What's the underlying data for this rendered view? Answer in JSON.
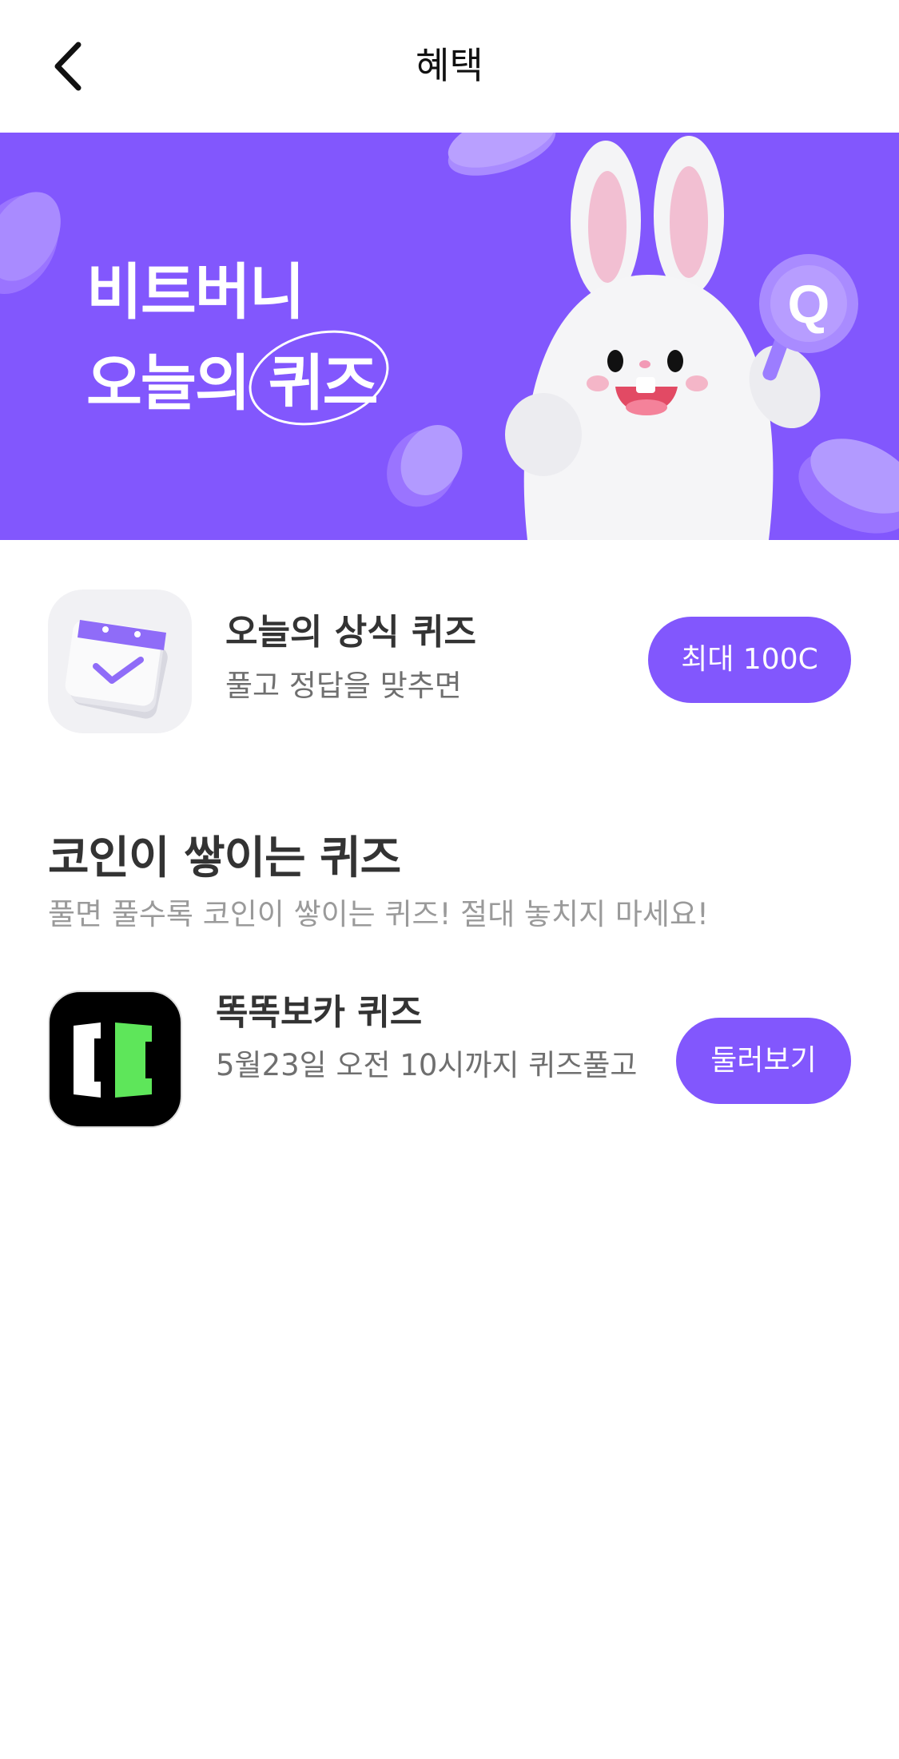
{
  "header": {
    "title": "혜택",
    "back_icon": "chevron-left-icon"
  },
  "banner": {
    "line1": "비트버니",
    "line2_prefix": "오늘의",
    "line2_highlight": "퀴즈",
    "mascot": "rabbit-mascot",
    "mascot_badge": "Q",
    "colors": {
      "background": "#8257fd",
      "coin": "#a98bff"
    }
  },
  "daily_quiz": {
    "icon": "calendar-check-icon",
    "title": "오늘의 상식 퀴즈",
    "subtitle": "풀고 정답을 맞추면",
    "button_label": "최대 100C"
  },
  "coin_quiz_section": {
    "title": "코인이 쌓이는 퀴즈",
    "subtitle": "풀면 풀수록 코인이 쌓이는 퀴즈! 절대 놓치지 마세요!",
    "items": [
      {
        "icon": "ttokttok-voca-logo",
        "title": "똑똑보카 퀴즈",
        "description": "5월23일 오전 10시까지 퀴즈풀고",
        "button_label": "둘러보기"
      }
    ]
  },
  "colors": {
    "accent": "#8257fd",
    "logo_green": "#5ee65a"
  }
}
